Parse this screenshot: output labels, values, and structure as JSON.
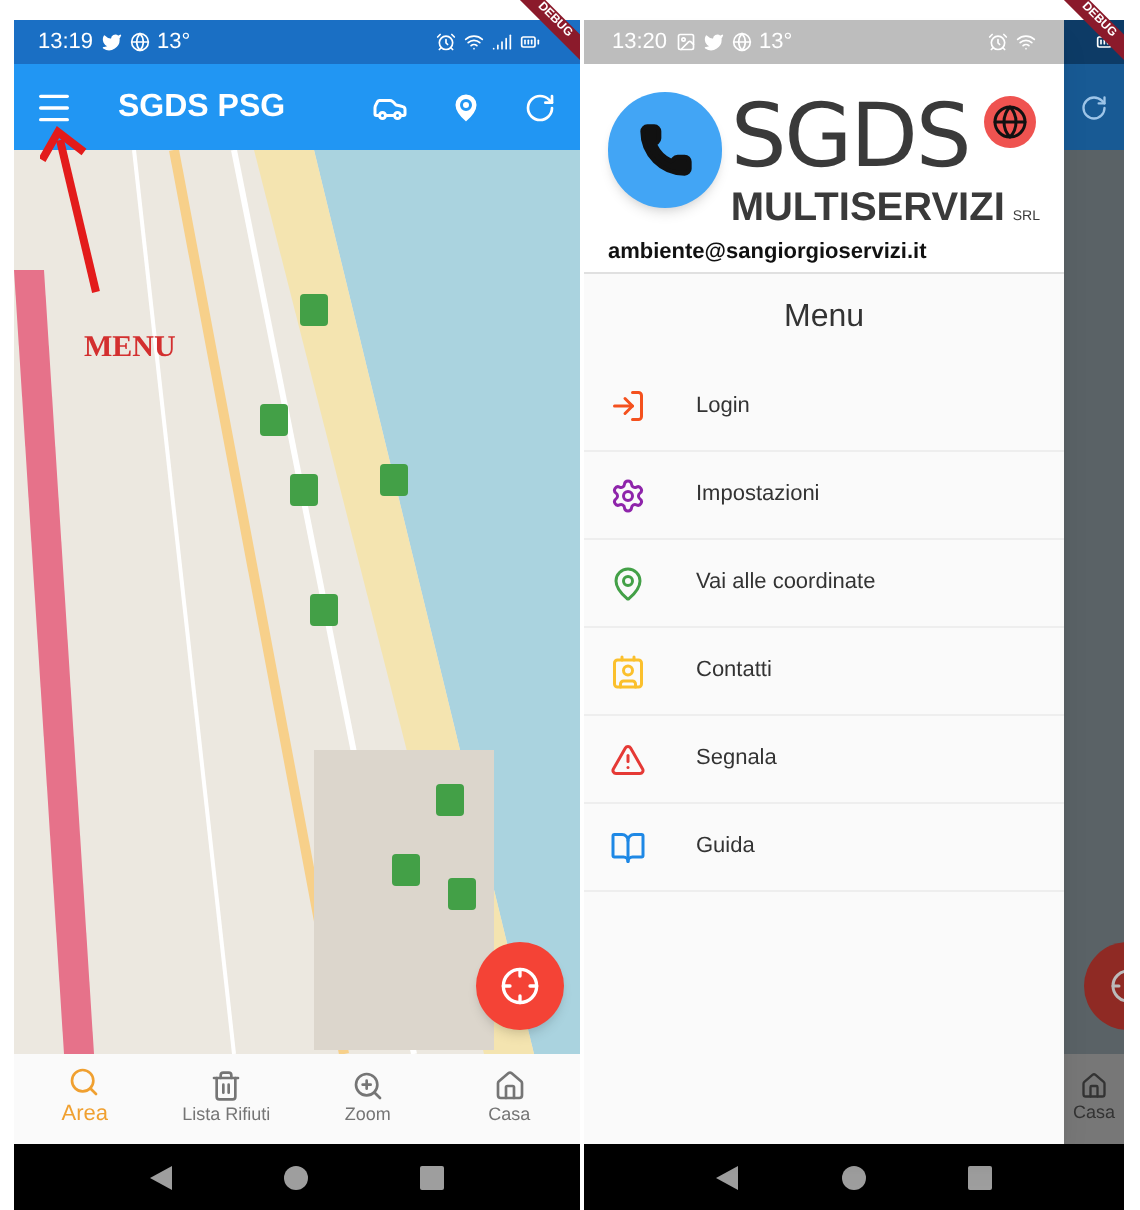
{
  "left_screen": {
    "status_bar": {
      "time": "13:19",
      "temperature": "13°"
    },
    "app_bar": {
      "title": "SGDS PSG"
    },
    "annotation": {
      "label": "MENU"
    },
    "bottom_nav": [
      {
        "label": "Area",
        "selected": true
      },
      {
        "label": "Lista Rifiuti",
        "selected": false
      },
      {
        "label": "Zoom",
        "selected": false
      },
      {
        "label": "Casa",
        "selected": false
      }
    ],
    "debug_banner": "DEBUG"
  },
  "right_screen": {
    "status_bar": {
      "time": "13:20",
      "temperature": "13°"
    },
    "drawer": {
      "logo": {
        "title": "SGDS",
        "subtitle": "MULTISERVIZI",
        "suffix": "SRL"
      },
      "email": "ambiente@sangiorgioservizi.it",
      "title": "Menu",
      "items": [
        {
          "label": "Login",
          "color": "#f4511e"
        },
        {
          "label": "Impostazioni",
          "color": "#8e24aa"
        },
        {
          "label": "Vai alle coordinate",
          "color": "#43a047"
        },
        {
          "label": "Contatti",
          "color": "#fbc02d"
        },
        {
          "label": "Segnala",
          "color": "#e53935"
        },
        {
          "label": "Guida",
          "color": "#1e88e5"
        }
      ]
    },
    "background_nav_label": "Casa",
    "debug_banner": "DEBUG"
  }
}
